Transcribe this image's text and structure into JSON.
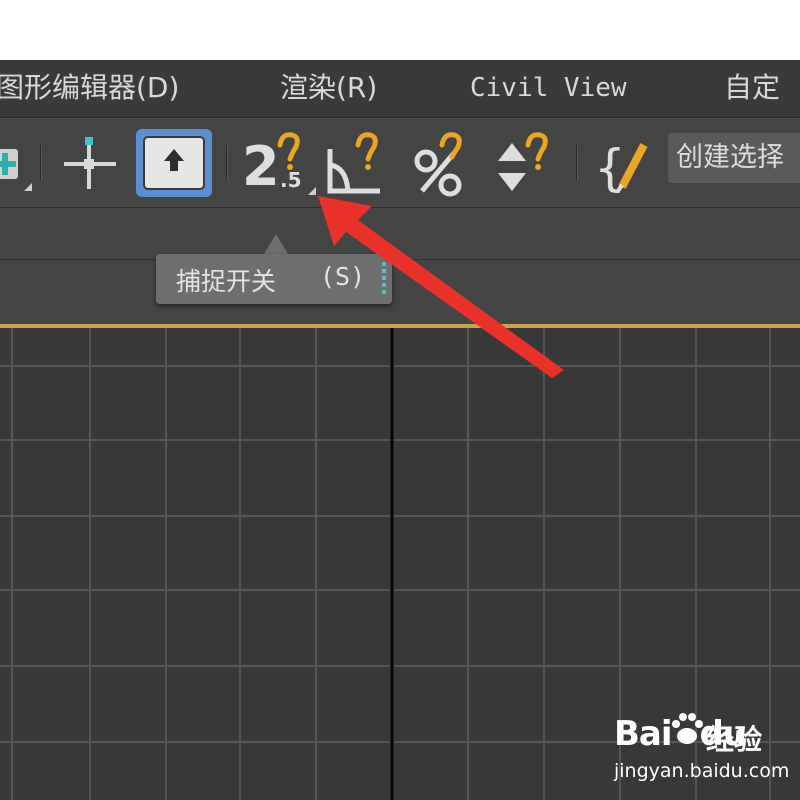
{
  "menubar": {
    "items": [
      {
        "label": "图形编辑器(D)"
      },
      {
        "label": "渲染(R)"
      },
      {
        "label": "Civil View"
      },
      {
        "label": "自定"
      }
    ]
  },
  "toolbar": {
    "buttons": [
      {
        "icon": "link-plus-icon"
      },
      {
        "icon": "move-axis-icon"
      },
      {
        "icon": "select-arrow-icon",
        "state": "active"
      },
      {
        "icon": "snap-2-5d-icon",
        "text": "2",
        "sub": ".5"
      },
      {
        "icon": "angle-snap-icon"
      },
      {
        "icon": "percent-snap-icon",
        "text": "%"
      },
      {
        "icon": "spinner-snap-icon"
      },
      {
        "icon": "named-selection-icon",
        "text": "{"
      }
    ],
    "create_selection_label": "创建选择"
  },
  "tooltip": {
    "label": "捕捉开关",
    "shortcut": "(S)"
  },
  "annotation": {
    "arrow_color": "#e8322a"
  },
  "watermark": {
    "brand": "Bai",
    "brand_suffix": "du",
    "cn_label": "经验",
    "url": "jingyan.baidu.com"
  },
  "colors": {
    "menubar_bg": "#3a3a3a",
    "toolbar_bg": "#444444",
    "viewport_bg": "#383838",
    "viewport_border": "#c9a24a",
    "active_button": "#5b8fd1",
    "snap_accent": "#e8a526"
  }
}
